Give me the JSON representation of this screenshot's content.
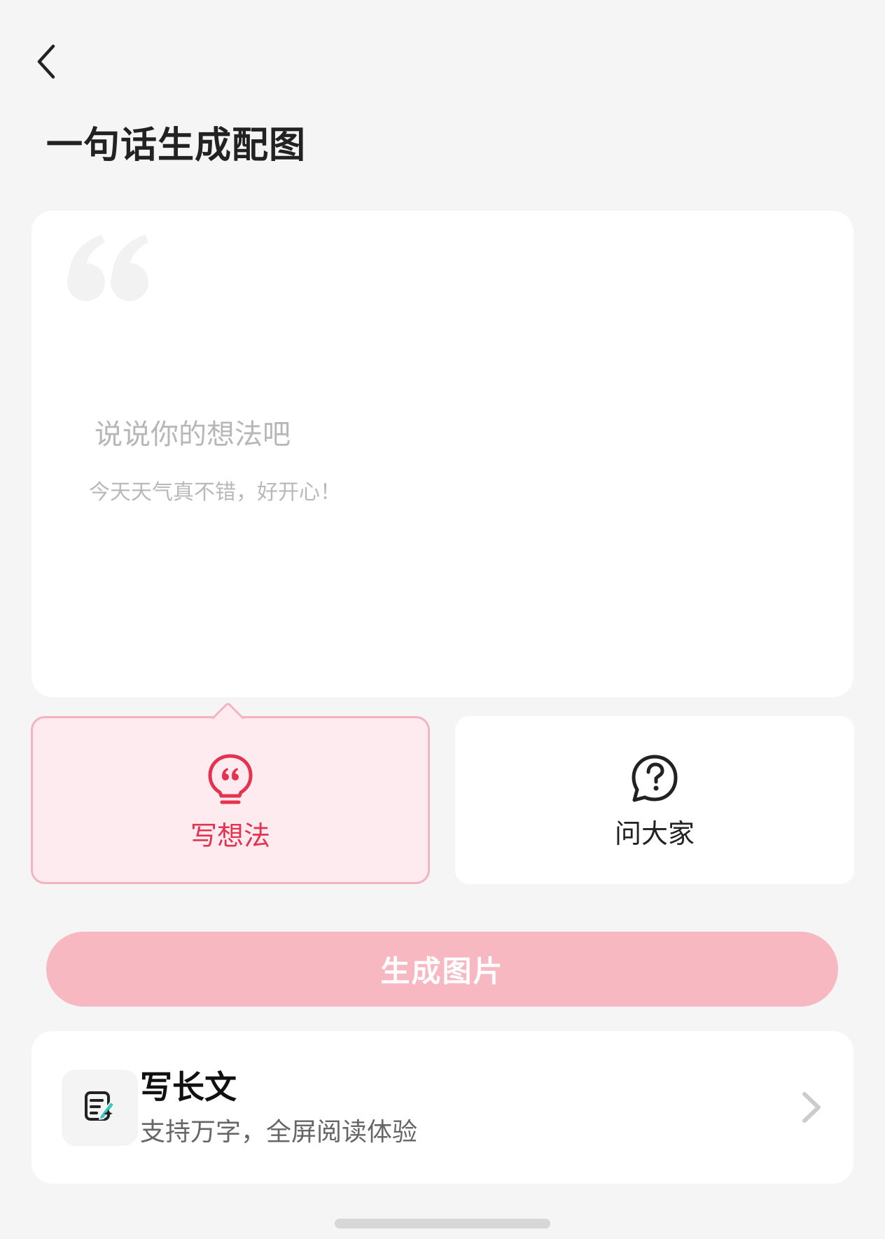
{
  "header": {
    "back_icon": "chevron-left-icon",
    "title": "一句话生成配图"
  },
  "editor": {
    "quote_icon": "quote-mark-icon",
    "placeholder": "说说你的想法吧",
    "value": "",
    "example": "今天天气真不错，好开心！"
  },
  "modes": [
    {
      "label": "写想法",
      "icon": "lightbulb-quote-icon",
      "selected": true,
      "color": "#e5334f"
    },
    {
      "label": "问大家",
      "icon": "question-bubble-icon",
      "selected": false,
      "color": "#222222"
    }
  ],
  "generate_button": {
    "label": "生成图片",
    "background": "#f7b8c1",
    "enabled": false
  },
  "long_article": {
    "icon": "edit-document-icon",
    "title": "写长文",
    "subtitle": "支持万字，全屏阅读体验",
    "chevron": "chevron-right-icon"
  },
  "colors": {
    "accent": "#e5334f",
    "accent_light": "#fdebef",
    "background": "#f5f5f5"
  }
}
